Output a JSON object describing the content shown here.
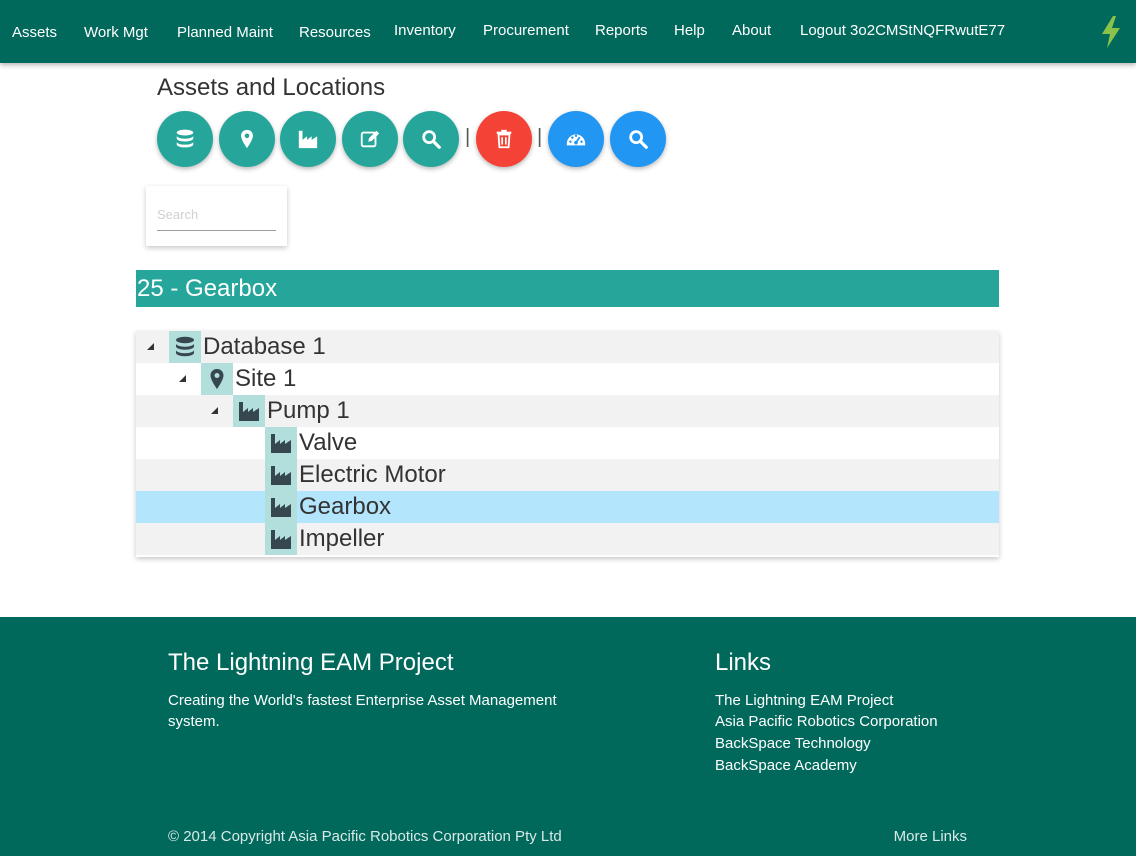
{
  "nav": {
    "items": [
      "Assets",
      "Work Mgt",
      "Planned Maint",
      "Resources",
      "Inventory",
      "Procurement",
      "Reports",
      "Help",
      "About",
      "Logout 3o2CMStNQFRwutE77"
    ],
    "logo_icon": "lightning-bolt-icon",
    "logo_color": "#8bc34a"
  },
  "toolbar": {
    "title": "Assets and Locations",
    "buttons": [
      {
        "icon": "database-icon",
        "color": "teal"
      },
      {
        "icon": "map-marker-icon",
        "color": "teal"
      },
      {
        "icon": "industry-icon",
        "color": "teal"
      },
      {
        "icon": "edit-icon",
        "color": "teal"
      },
      {
        "icon": "search-icon",
        "color": "teal"
      },
      {
        "icon": "trash-icon",
        "color": "red"
      },
      {
        "icon": "dashboard-icon",
        "color": "blue"
      },
      {
        "icon": "search-icon",
        "color": "blue"
      }
    ],
    "separator": "|"
  },
  "search": {
    "placeholder": "Search",
    "value": ""
  },
  "selected": {
    "label": "25 - Gearbox"
  },
  "tree": {
    "nodes": [
      {
        "label": "Database 1",
        "icon": "database-icon",
        "level": 0,
        "expanded": true
      },
      {
        "label": "Site 1",
        "icon": "map-marker-icon",
        "level": 1,
        "expanded": true
      },
      {
        "label": "Pump 1",
        "icon": "industry-icon",
        "level": 2,
        "expanded": true
      },
      {
        "label": "Valve",
        "icon": "industry-icon",
        "level": 3
      },
      {
        "label": "Electric Motor",
        "icon": "industry-icon",
        "level": 3
      },
      {
        "label": "Gearbox",
        "icon": "industry-icon",
        "level": 3,
        "selected": true
      },
      {
        "label": "Impeller",
        "icon": "industry-icon",
        "level": 3
      }
    ]
  },
  "footer": {
    "about_title": "The Lightning EAM Project",
    "about_text": "Creating the World's fastest Enterprise Asset Management system.",
    "links_title": "Links",
    "links": [
      "The Lightning EAM Project",
      "Asia Pacific Robotics Corporation",
      "BackSpace Technology",
      "BackSpace Academy"
    ],
    "copyright": "© 2014 Copyright Asia Pacific Robotics Corporation Pty Ltd",
    "more_links": "More Links"
  },
  "colors": {
    "primary": "#00695c",
    "accent": "#26a69a",
    "danger": "#f44336",
    "info": "#2196f3",
    "selected_row": "#b3e5fc",
    "icon_bg": "#b2dfdb"
  }
}
